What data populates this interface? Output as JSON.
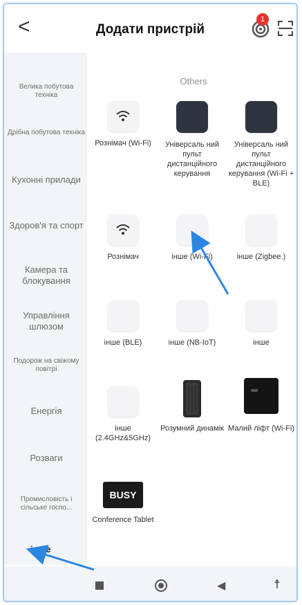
{
  "header": {
    "back_glyph": "<",
    "title": "Додати пристрій",
    "notification_count": "1",
    "back_icon": "chevron-left-icon",
    "notification_icon": "target-icon",
    "scan_icon": "scan-icon"
  },
  "sidebar": {
    "items": [
      {
        "label": "Велика побутова техніка"
      },
      {
        "label": "Дрібна побутова техніка"
      },
      {
        "label": "Кухонні прилади"
      },
      {
        "label": "Здоров'я та спорт"
      },
      {
        "label": "Камера та блокування"
      },
      {
        "label": "Управління шлюзом"
      },
      {
        "label": "Подорож на свіжому повітрі"
      },
      {
        "label": "Енергія"
      },
      {
        "label": "Розваги"
      },
      {
        "label": "Промисловість і сільське госпо..."
      },
      {
        "label": "інше"
      }
    ]
  },
  "main": {
    "section_title": "Others",
    "devices": [
      {
        "label": "Рознімач (Wi-Fi)"
      },
      {
        "label": "Універсаль ний пульт дистанційного керування"
      },
      {
        "label": "Універсаль ний пульт дистанційного керування (Wi-Fi + BLE)"
      },
      {
        "label": "Рознімач"
      },
      {
        "label": "інше (Wi-Fi)"
      },
      {
        "label": "інше (Zigbee.)"
      },
      {
        "label": "інше (BLE)"
      },
      {
        "label": "інше (NB-IoT)"
      },
      {
        "label": "інше"
      },
      {
        "label": "інше (2.4GHz&5GHz)"
      },
      {
        "label": "Розумний динамік"
      },
      {
        "label": "Малий ліфт (Wi-Fi)"
      },
      {
        "label": "Conference Tablet"
      }
    ],
    "busy_text": "BUSY"
  },
  "navbar": {
    "recent_icon": "square-icon",
    "home_icon": "circle-icon",
    "back_icon": "triangle-back-icon",
    "accessibility_icon": "accessibility-icon"
  },
  "colors": {
    "accent_arrow": "#2a86e0",
    "badge": "#e8332e",
    "frame": "#9fc9f0"
  }
}
